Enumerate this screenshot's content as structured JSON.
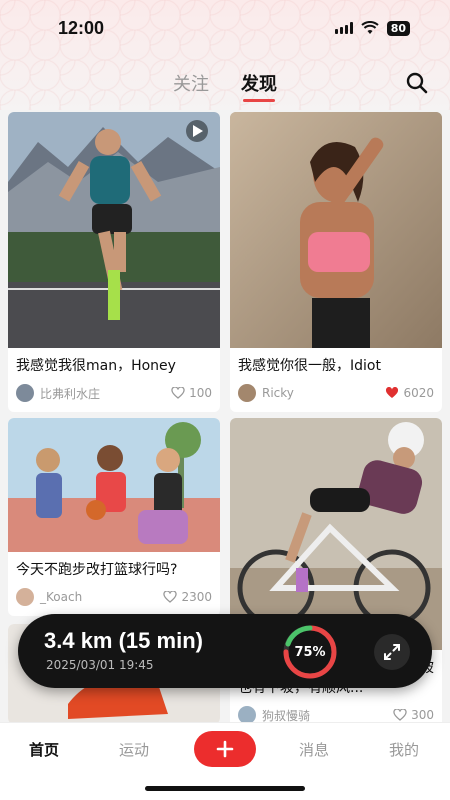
{
  "status": {
    "time": "12:00",
    "battery": "80"
  },
  "header": {
    "tabs": [
      {
        "label": "关注",
        "active": false
      },
      {
        "label": "发现",
        "active": true
      }
    ]
  },
  "feed": [
    {
      "title": "我感觉我很man，Honey",
      "author": "比弗利水庄",
      "likes": "100",
      "liked": false,
      "video": true
    },
    {
      "title": "我感觉你很一般，Idiot",
      "author": "Ricky",
      "likes": "6020",
      "liked": true,
      "video": false
    },
    {
      "title": "今天不跑步改打篮球行吗?",
      "author": "_Koach",
      "likes": "2300",
      "liked": false,
      "video": false
    },
    {
      "title": "或许人生就像一次骑行，有上坡也有下坡，有顺风...",
      "author": "狗叔慢骑",
      "likes": "300",
      "liked": false,
      "video": false
    }
  ],
  "tracker": {
    "distance": "3.4 km (15 min)",
    "datetime": "2025/03/01 19:45",
    "progress_label": "75%",
    "progress": 0.75
  },
  "bottom_nav": {
    "items": [
      {
        "label": "首页",
        "active": true
      },
      {
        "label": "运动",
        "active": false
      },
      {
        "label": "消息",
        "active": false
      },
      {
        "label": "我的",
        "active": false
      }
    ]
  },
  "colors": {
    "accent": "#e84545",
    "add_button": "#ec2d2d",
    "liked_heart": "#e03030"
  }
}
